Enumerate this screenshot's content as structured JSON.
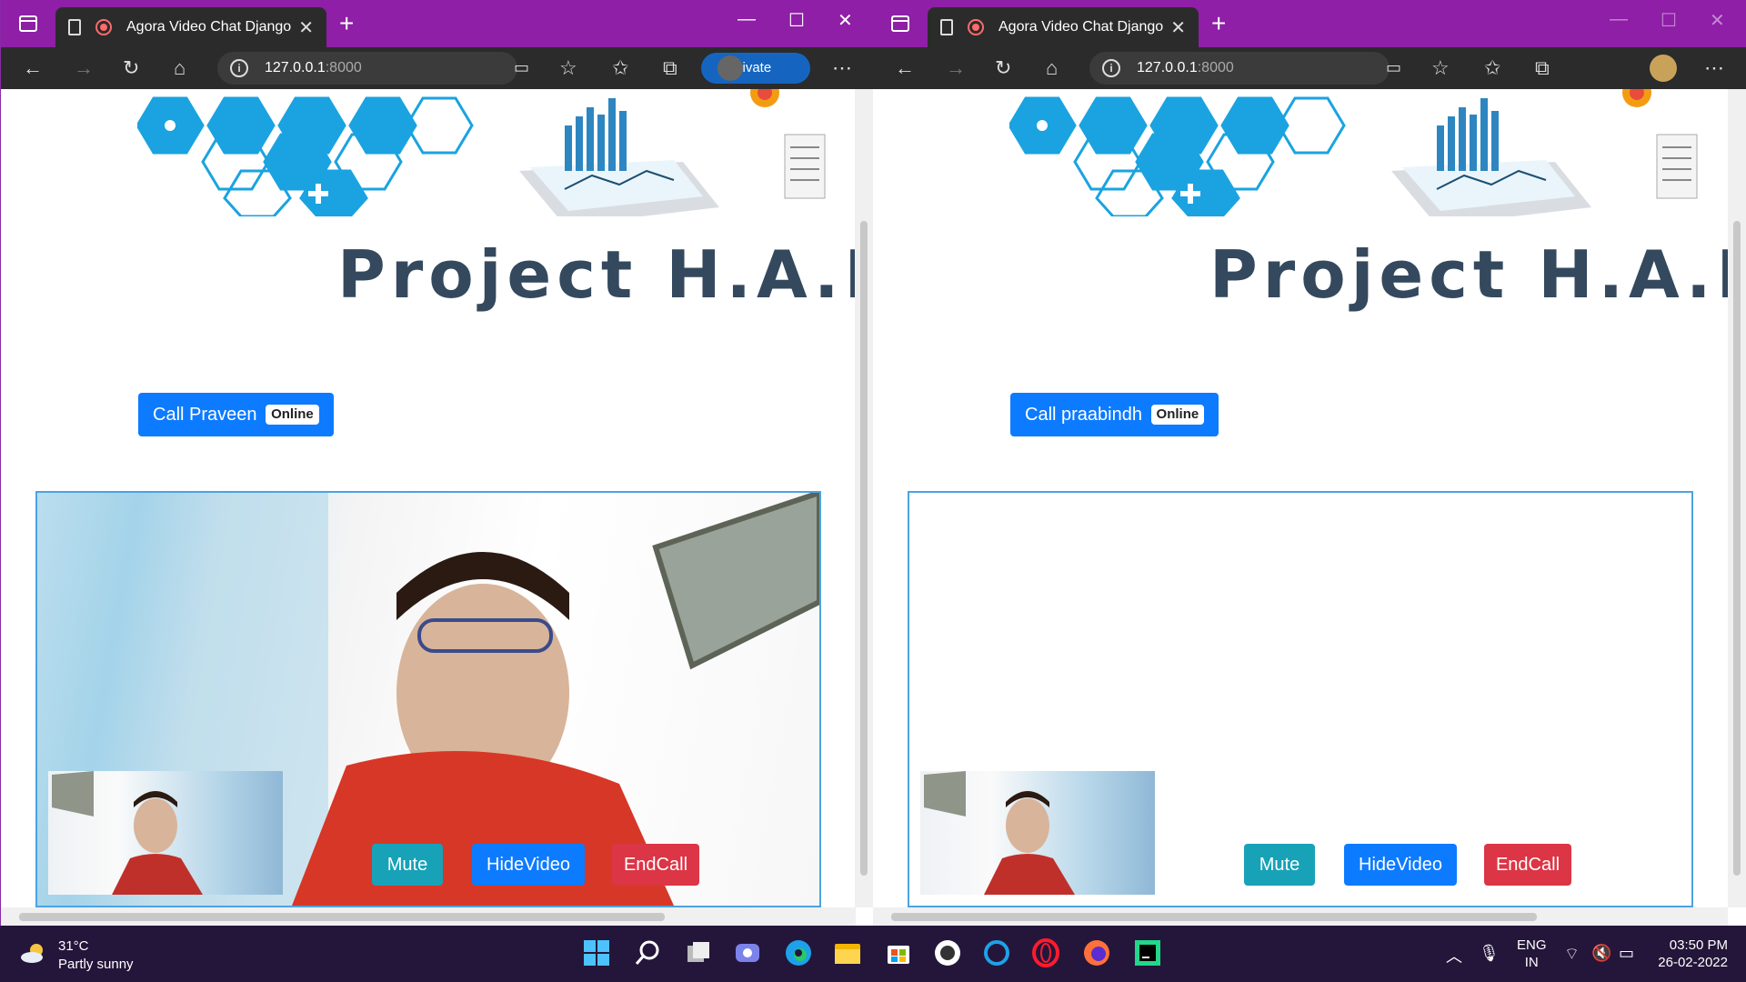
{
  "windows": [
    {
      "tab_title": "Agora Video Chat Django",
      "url_host": "127.0.0.1",
      "url_port": ":8000",
      "profile_label": "InPrivate",
      "heading": "Project H.A.L.I",
      "call_button": {
        "label": "Call Praveen",
        "badge": "Online"
      },
      "controls": {
        "mute": "Mute",
        "hide_video": "HideVideo",
        "end_call": "EndCall"
      },
      "remote_video_active": true
    },
    {
      "tab_title": "Agora Video Chat Django",
      "url_host": "127.0.0.1",
      "url_port": ":8000",
      "heading": "Project H.A.L.I",
      "call_button": {
        "label": "Call praabindh",
        "badge": "Online"
      },
      "controls": {
        "mute": "Mute",
        "hide_video": "HideVideo",
        "end_call": "EndCall"
      },
      "remote_video_active": false
    }
  ],
  "taskbar": {
    "weather_temp": "31°C",
    "weather_desc": "Partly sunny",
    "lang_1": "ENG",
    "lang_2": "IN",
    "time": "03:50 PM",
    "date": "26-02-2022",
    "apps": [
      "start-icon",
      "search-icon",
      "task-view-icon",
      "chat-icon",
      "edge-icon",
      "file-explorer-icon",
      "store-icon",
      "app-icon",
      "cortana-icon",
      "opera-icon",
      "firefox-icon",
      "pycharm-icon"
    ]
  },
  "colors": {
    "titlebar": "#8e1fa6",
    "primary_button": "#0d7bff",
    "mute_button": "#17a2b8",
    "end_button": "#dc3545",
    "heading": "#34495e"
  }
}
